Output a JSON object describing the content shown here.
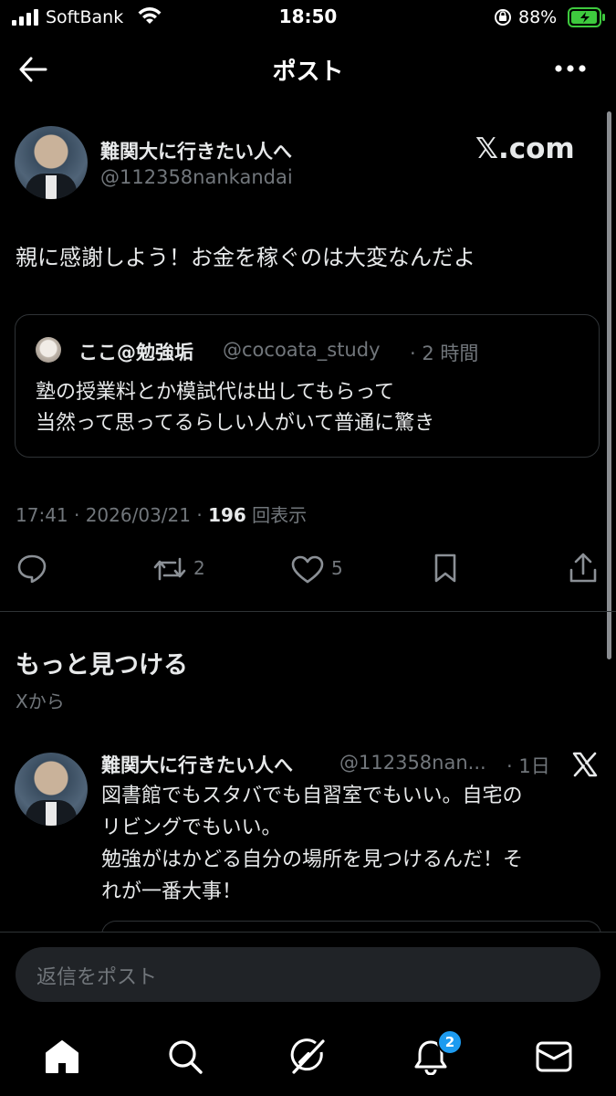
{
  "status_bar": {
    "carrier": "SoftBank",
    "time": "18:50",
    "battery": "88%"
  },
  "header": {
    "title": "ポスト"
  },
  "post": {
    "author_name": "難関大に行きたい人へ",
    "author_handle": "@112358nankandai",
    "source_label": "𝕏.com",
    "text": "親に感謝しよう！お金を稼ぐのは大変なんだよ",
    "quote": {
      "author_name": "ここ@勉強垢",
      "author_handle": "@cocoata_study",
      "time": "· 2 時間",
      "line1": "塾の授業料とか模試代は出してもらって",
      "line2": "当然って思ってるらしい人がいて普通に驚き"
    },
    "timestamp": "17:41 · 2026/03/21 ·",
    "views_count": "196",
    "views_label": "回表示",
    "reposts": "2",
    "likes": "5"
  },
  "discover": {
    "title": "もっと見つける",
    "subtitle": "Xから",
    "item": {
      "author_name": "難関大に行きたい人へ",
      "author_handle": "@112358nan...",
      "time": "· 1日",
      "line1": "図書館でもスタバでも自習室でもいい。自宅の",
      "line2": "リビングでもいい。",
      "line3": "勉強がはかどる自分の場所を見つけるんだ！そ",
      "line4": "れが一番大事！"
    }
  },
  "reply": {
    "placeholder": "返信をポスト"
  },
  "bottom_nav": {
    "notifications_badge": "2"
  },
  "colors": {
    "background": "#000000",
    "text": "#e7e9ea",
    "secondary": "#71767b",
    "accent": "#1d9bf0",
    "battery": "#3ec93e"
  }
}
